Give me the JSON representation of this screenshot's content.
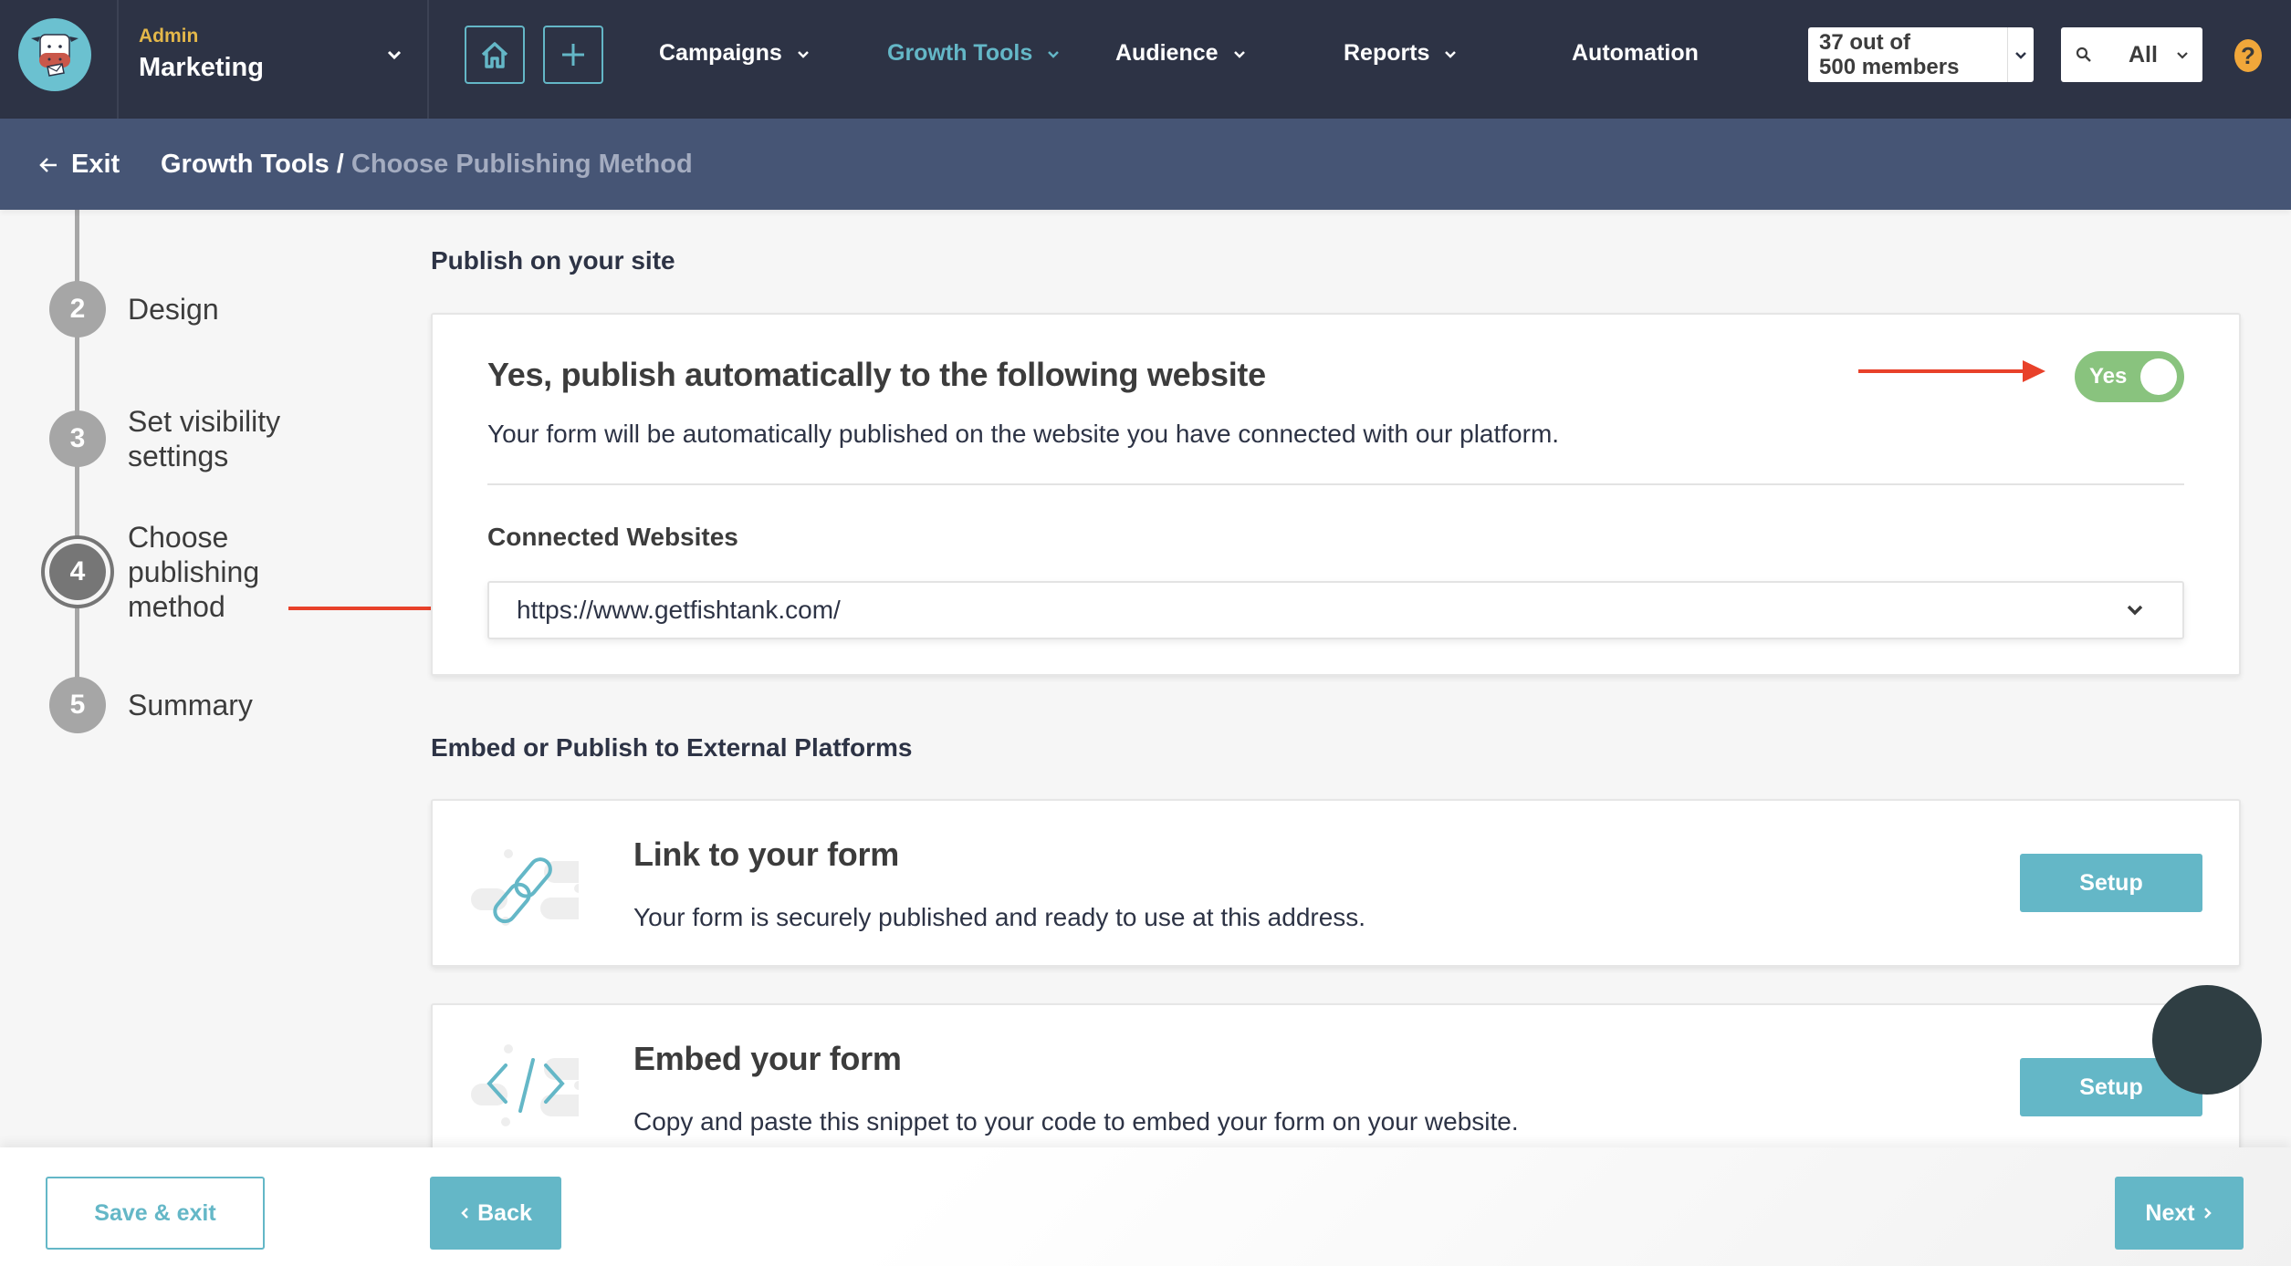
{
  "topnav": {
    "account_role": "Admin",
    "account_name": "Marketing",
    "home_icon": "home-icon",
    "add_icon": "plus-icon",
    "items": [
      {
        "label": "Campaigns",
        "has_dropdown": true,
        "active": false
      },
      {
        "label": "Growth Tools",
        "has_dropdown": true,
        "active": true
      },
      {
        "label": "Audience",
        "has_dropdown": true,
        "active": false
      },
      {
        "label": "Reports",
        "has_dropdown": true,
        "active": false
      },
      {
        "label": "Automation",
        "has_dropdown": false,
        "active": false
      }
    ],
    "members_line1": "37 out of",
    "members_line2": "500 members",
    "search_scope": "All",
    "help_label": "?"
  },
  "breadcrumb": {
    "exit_label": "Exit",
    "parent": "Growth Tools",
    "separator": "/",
    "current": "Choose Publishing Method"
  },
  "steps": [
    {
      "number": "2",
      "label": "Design",
      "state": "done"
    },
    {
      "number": "3",
      "label": "Set visibility settings",
      "state": "done"
    },
    {
      "number": "4",
      "label": "Choose publishing method",
      "state": "current"
    },
    {
      "number": "5",
      "label": "Summary",
      "state": "upcoming"
    }
  ],
  "publish_section": {
    "heading": "Publish on your site",
    "title": "Yes, publish automatically to the following website",
    "description": "Your form will be automatically published on the website you have connected with our platform.",
    "toggle_label": "Yes",
    "toggle_on": true,
    "connected_label": "Connected Websites",
    "connected_value": "https://www.getfishtank.com/"
  },
  "external_section": {
    "heading": "Embed or Publish to External Platforms",
    "cards": [
      {
        "icon": "link-icon",
        "title": "Link to your form",
        "description": "Your form is securely published and ready to use at this address.",
        "button": "Setup"
      },
      {
        "icon": "code-icon",
        "title": "Embed your form",
        "description": "Copy and paste this snippet to your code to embed your form on your website.",
        "button": "Setup"
      }
    ]
  },
  "footer": {
    "save_exit": "Save & exit",
    "back": "Back",
    "next": "Next"
  },
  "colors": {
    "nav_bg": "#2d3345",
    "breadcrumb_bg": "#465575",
    "accent": "#64b7c7",
    "toggle_on": "#89c37e",
    "annotation_arrow": "#e8412a",
    "admin_label": "#e4b84a",
    "help_badge": "#f1a73a"
  }
}
